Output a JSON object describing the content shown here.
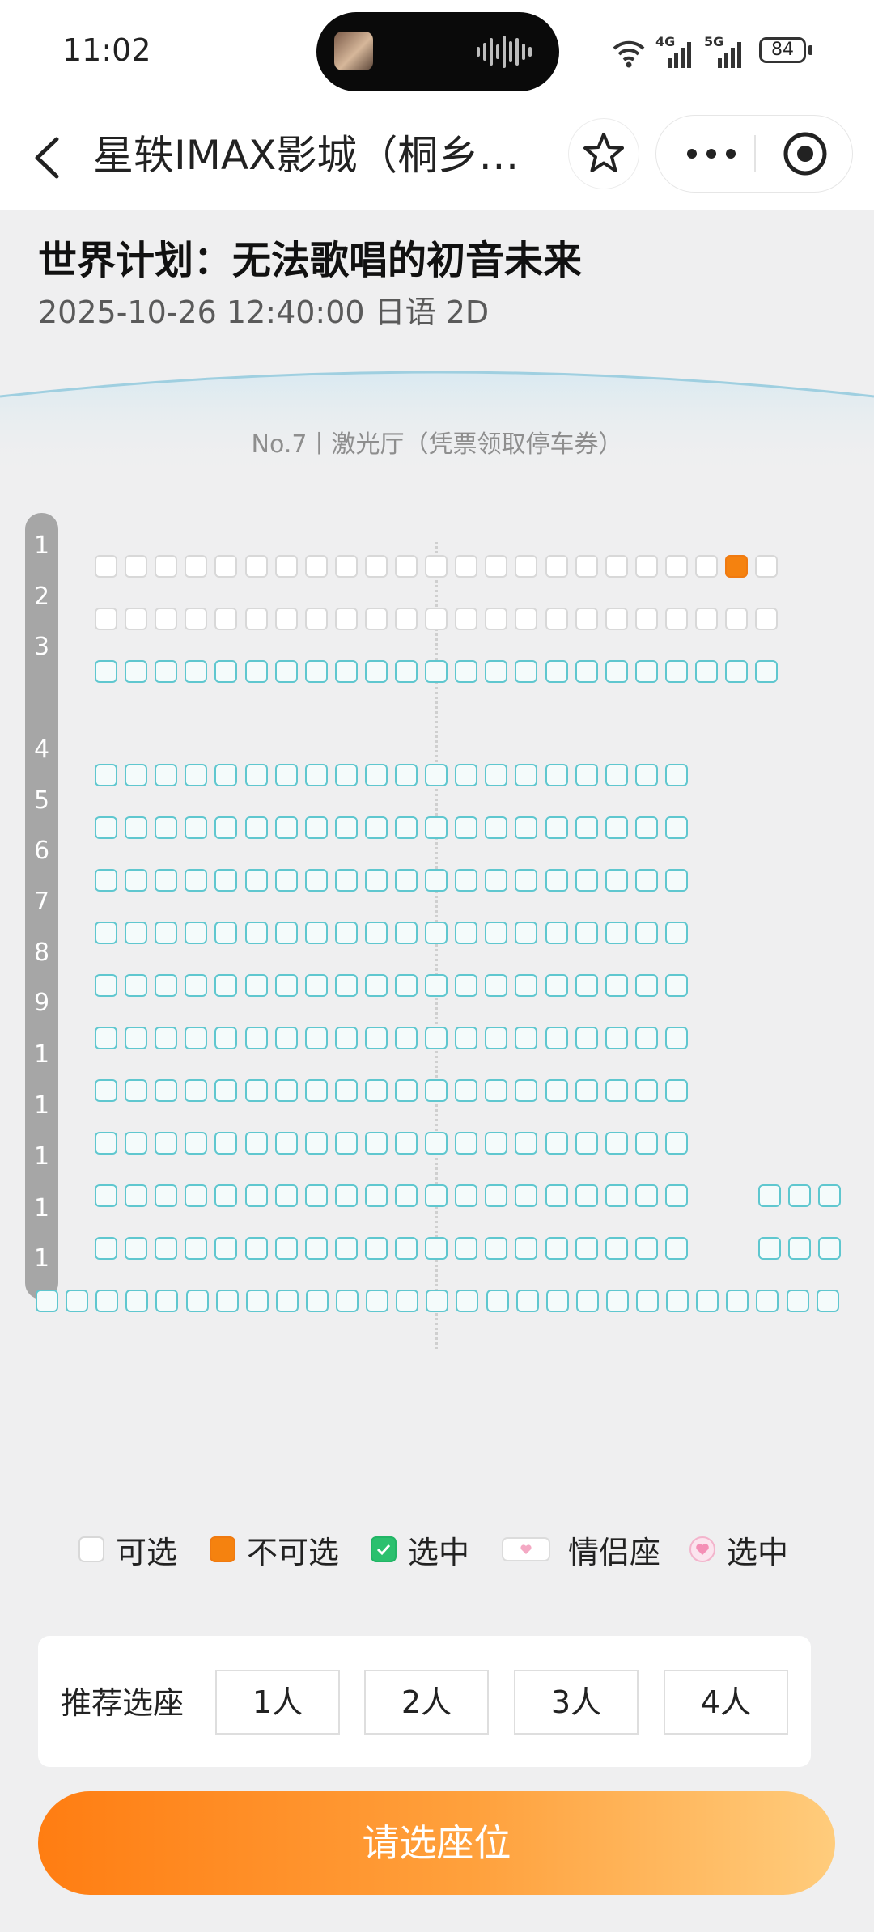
{
  "status": {
    "time": "11:02",
    "net1": "4G",
    "net2": "5G",
    "battery": "84"
  },
  "nav": {
    "title": "星轶IMAX影城（桐乡…"
  },
  "movie": {
    "title": "世界计划：无法歌唱的初音未来",
    "info": "2025-10-26 12:40:00 日语 2D"
  },
  "hall": {
    "label": "No.7丨激光厅（凭票领取停车券）"
  },
  "rows": [
    "1",
    "2",
    "3",
    "4",
    "5",
    "6",
    "7",
    "8",
    "9",
    "1",
    "1",
    "1",
    "1",
    "1"
  ],
  "legend": {
    "available": "可选",
    "sold": "不可选",
    "selected": "选中",
    "couple": "情侣座",
    "couple_selected": "选中"
  },
  "recommend": {
    "label": "推荐选座",
    "options": [
      "1人",
      "2人",
      "3人",
      "4人"
    ]
  },
  "cta": "请选座位",
  "colors": {
    "accent": "#f5820f",
    "seat_outline": "#5fc7cf",
    "selected": "#2bc06e",
    "couple": "#f4a9c4"
  }
}
